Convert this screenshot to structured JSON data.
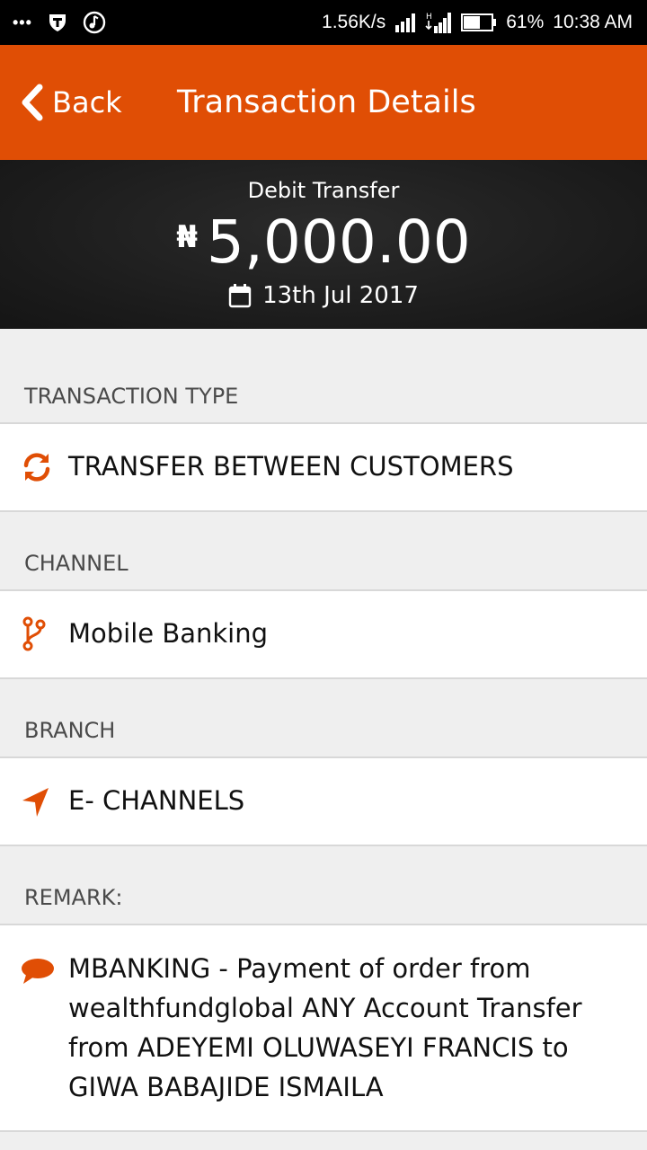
{
  "status_bar": {
    "dots": "•••",
    "speed": "1.56K/s",
    "battery": "61%",
    "time": "10:38 AM",
    "network_type": "H"
  },
  "header": {
    "back_label": "Back",
    "title": "Transaction Details",
    "color": "#e04e05"
  },
  "summary": {
    "type": "Debit Transfer",
    "currency_symbol": "₦",
    "amount": "5,000.00",
    "date": "13th Jul 2017"
  },
  "sections": {
    "transaction_type": {
      "label": "TRANSACTION TYPE",
      "value": "TRANSFER BETWEEN CUSTOMERS",
      "icon": "refresh-icon"
    },
    "channel": {
      "label": "CHANNEL",
      "value": "Mobile Banking",
      "icon": "branch-fork-icon"
    },
    "branch": {
      "label": "BRANCH",
      "value": "E- CHANNELS",
      "icon": "location-arrow-icon"
    },
    "remark": {
      "label": "REMARK:",
      "lines": [
        "MBANKING - Payment of order from",
        "wealthfundglobal ANY Account Transfer",
        "from ADEYEMI OLUWASEYI FRANCIS to",
        "GIWA BABAJIDE ISMAILA"
      ],
      "icon": "comment-icon"
    }
  },
  "accent_color": "#e04e05"
}
